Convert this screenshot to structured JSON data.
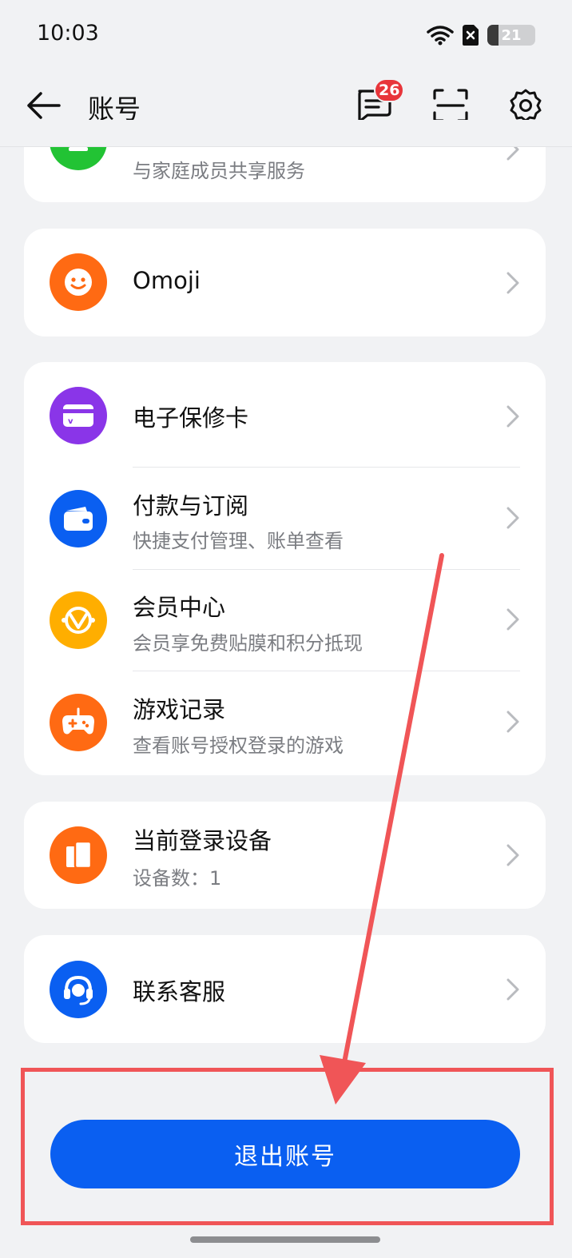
{
  "status_bar": {
    "time": "10:03",
    "battery_level": "21",
    "icons": [
      "wifi-icon",
      "sim-off-icon",
      "battery-icon"
    ]
  },
  "header": {
    "title": "账号",
    "message_badge": "26",
    "icons": [
      "back-arrow-icon",
      "message-icon",
      "scan-icon",
      "settings-icon"
    ]
  },
  "family_card": {
    "subtitle": "与家庭成员共享服务",
    "icon": "family-icon",
    "color": "#22c334"
  },
  "omoji_card": {
    "title": "Omoji",
    "icon": "smiley-icon",
    "color": "#ff6a13"
  },
  "service_items": [
    {
      "title": "电子保修卡",
      "subtitle": "",
      "icon": "warranty-card-icon",
      "color": "#8a35e8"
    },
    {
      "title": "付款与订阅",
      "subtitle": "快捷支付管理、账单查看",
      "icon": "wallet-icon",
      "color": "#0a5ff1"
    },
    {
      "title": "会员中心",
      "subtitle": "会员享免费贴膜和积分抵现",
      "icon": "member-v-icon",
      "color": "#ffae00"
    },
    {
      "title": "游戏记录",
      "subtitle": "查看账号授权登录的游戏",
      "icon": "gamepad-icon",
      "color": "#ff6a13"
    }
  ],
  "devices_card": {
    "title": "当前登录设备",
    "subtitle": "设备数：1",
    "icon": "devices-icon",
    "color": "#ff6a13"
  },
  "support_card": {
    "title": "联系客服",
    "icon": "headset-icon",
    "color": "#0a5ff1"
  },
  "logout": {
    "label": "退出账号"
  },
  "colors": {
    "accent": "#0a5ff1",
    "annotation": "#f05557",
    "background": "#f1f2f4"
  }
}
